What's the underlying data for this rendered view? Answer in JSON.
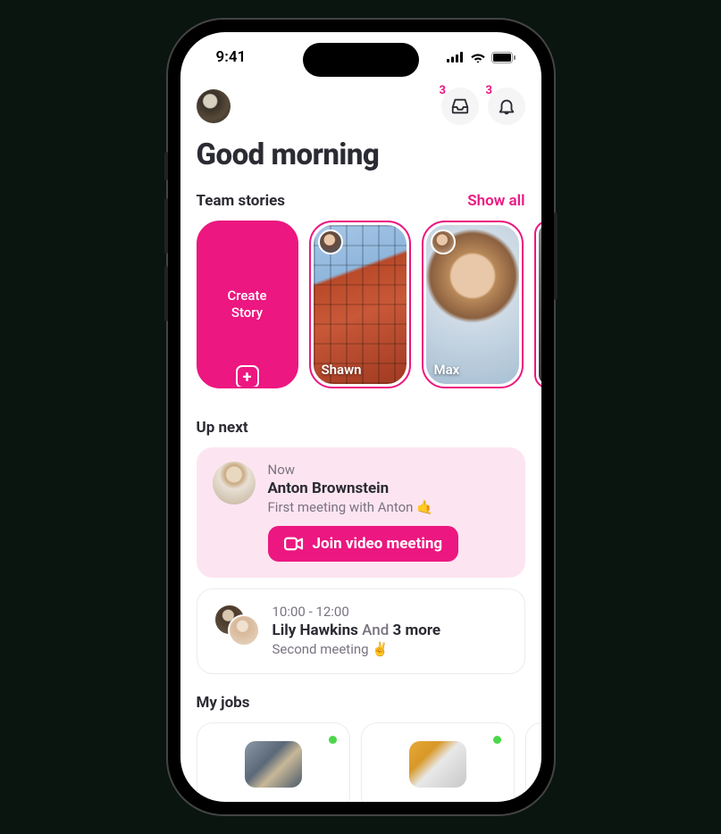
{
  "status": {
    "time": "9:41"
  },
  "header": {
    "inbox_badge": "3",
    "bell_badge": "3"
  },
  "greeting": "Good morning",
  "stories": {
    "title": "Team stories",
    "show_all": "Show all",
    "create_label": "Create\nStory",
    "items": [
      {
        "name": "Shawn"
      },
      {
        "name": "Max"
      }
    ]
  },
  "up_next": {
    "title": "Up next",
    "items": [
      {
        "when": "Now",
        "who": "Anton Brownstein",
        "what": "First meeting with Anton 🤙",
        "join_label": "Join video meeting"
      },
      {
        "when": "10:00 - 12:00",
        "who": "Lily Hawkins",
        "who_more_text": " And ",
        "who_more_count": "3 more",
        "what": "Second meeting ✌️"
      }
    ]
  },
  "my_jobs": {
    "title": "My jobs"
  },
  "colors": {
    "accent": "#ec1780"
  }
}
